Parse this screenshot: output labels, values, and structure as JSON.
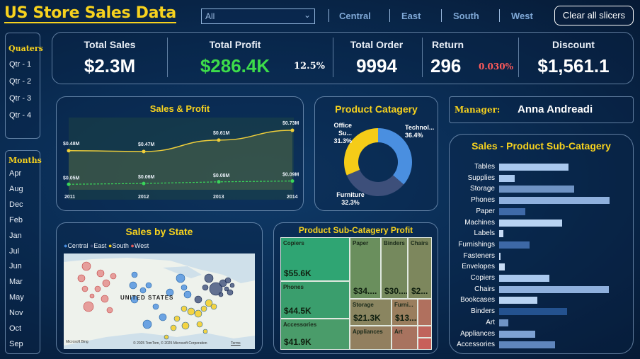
{
  "header": {
    "title": "US Store Sales Data",
    "dropdown_value": "All",
    "regions": [
      "Central",
      "East",
      "South",
      "West"
    ],
    "clear_label": "Clear all slicers"
  },
  "sidebar": {
    "quarters_title": "Quaters",
    "quarters": [
      "Qtr - 1",
      "Qtr - 2",
      "Qtr - 3",
      "Qtr - 4"
    ],
    "months_title": "Months",
    "months": [
      "Apr",
      "Aug",
      "Dec",
      "Feb",
      "Jan",
      "Jul",
      "Jun",
      "Mar",
      "May",
      "Nov",
      "Oct",
      "Sep"
    ]
  },
  "kpis": {
    "sales_label": "Total Sales",
    "sales_value": "$2.3M",
    "profit_label": "Total Profit",
    "profit_value": "$286.4K",
    "profit_pct": "12.5%",
    "order_label": "Total Order",
    "order_value": "9994",
    "return_label": "Return",
    "return_value": "296",
    "return_pct": "0.030%",
    "discount_label": "Discount",
    "discount_value": "$1,561.1",
    "profit_color": "#3ddc4a",
    "return_pct_color": "#ff5a5a"
  },
  "manager": {
    "label": "Manager:",
    "name": "Anna Andreadi"
  },
  "sales_profit": {
    "title": "Sales & Profit",
    "sales_labels": [
      "$0.48M",
      "$0.47M",
      "$0.61M",
      "$0.73M"
    ],
    "profit_labels": [
      "$0.05M",
      "$0.06M",
      "$0.08M",
      "$0.09M"
    ]
  },
  "product_category": {
    "title": "Product Catagery",
    "labels": [
      {
        "name": "Office Su...",
        "pct": "31.3%"
      },
      {
        "name": "Technol...",
        "pct": "36.4%"
      },
      {
        "name": "Furniture",
        "pct": "32.3%"
      }
    ]
  },
  "sales_by_state": {
    "title": "Sales by State",
    "legend": [
      "Central",
      "East",
      "South",
      "West"
    ],
    "map_label": "UNITED STATES",
    "map_brand": "Microsoft Bing",
    "map_copyright": "© 2025 TomTom, © 2025 Microsoft Corporation",
    "map_terms": "Terms"
  },
  "treemap": {
    "title": "Product Sub-Catagery Profit",
    "cells": [
      {
        "name": "Copiers",
        "value": "$55.6K"
      },
      {
        "name": "Phones",
        "value": "$44.5K"
      },
      {
        "name": "Accessories",
        "value": "$41.9K"
      },
      {
        "name": "Paper",
        "value": "$34...."
      },
      {
        "name": "Binders",
        "value": "$30...."
      },
      {
        "name": "Chairs",
        "value": "$2..."
      },
      {
        "name": "Storage",
        "value": "$21.3K"
      },
      {
        "name": "Furni...",
        "value": "$13...."
      },
      {
        "name": "Appliances",
        "value": ""
      },
      {
        "name": "Art",
        "value": ""
      }
    ]
  },
  "sub_category": {
    "title": "Sales - Product Sub-Catagery",
    "items": [
      {
        "name": "Tables",
        "value": 207
      },
      {
        "name": "Supplies",
        "value": 47
      },
      {
        "name": "Storage",
        "value": 224
      },
      {
        "name": "Phones",
        "value": 330
      },
      {
        "name": "Paper",
        "value": 79
      },
      {
        "name": "Machines",
        "value": 189
      },
      {
        "name": "Labels",
        "value": 12
      },
      {
        "name": "Furnishings",
        "value": 92
      },
      {
        "name": "Fasteners",
        "value": 3
      },
      {
        "name": "Envelopes",
        "value": 16
      },
      {
        "name": "Copiers",
        "value": 150
      },
      {
        "name": "Chairs",
        "value": 328
      },
      {
        "name": "Bookcases",
        "value": 115
      },
      {
        "name": "Binders",
        "value": 204
      },
      {
        "name": "Art",
        "value": 27
      },
      {
        "name": "Appliances",
        "value": 107
      },
      {
        "name": "Accessories",
        "value": 167
      }
    ]
  },
  "chart_data": [
    {
      "type": "line",
      "title": "Sales & Profit",
      "x": [
        "2011",
        "2012",
        "2013",
        "2014"
      ],
      "series": [
        {
          "name": "Sales",
          "values": [
            0.48,
            0.47,
            0.61,
            0.73
          ]
        },
        {
          "name": "Profit",
          "values": [
            0.05,
            0.06,
            0.08,
            0.09
          ]
        }
      ]
    },
    {
      "type": "pie",
      "title": "Product Catagery",
      "categories": [
        "Office Su...",
        "Technol...",
        "Furniture"
      ],
      "values": [
        31.3,
        36.4,
        32.3
      ]
    },
    {
      "type": "bar",
      "title": "Sales - Product Sub-Catagery",
      "categories": [
        "Tables",
        "Supplies",
        "Storage",
        "Phones",
        "Paper",
        "Machines",
        "Labels",
        "Furnishings",
        "Fasteners",
        "Envelopes",
        "Copiers",
        "Chairs",
        "Bookcases",
        "Binders",
        "Art",
        "Appliances",
        "Accessories"
      ],
      "values": [
        207,
        47,
        224,
        330,
        79,
        189,
        12,
        92,
        3,
        16,
        150,
        328,
        115,
        204,
        27,
        107,
        167
      ]
    }
  ],
  "colors": {
    "accent": "#f7d21e",
    "central": "#4a8fe0",
    "east": "#3d4f7a",
    "south": "#f5cc18",
    "west": "#e05a5a",
    "treemap_dark": "#3aa070",
    "treemap_mid": "#6f8a5e",
    "treemap_brown": "#a07560"
  }
}
